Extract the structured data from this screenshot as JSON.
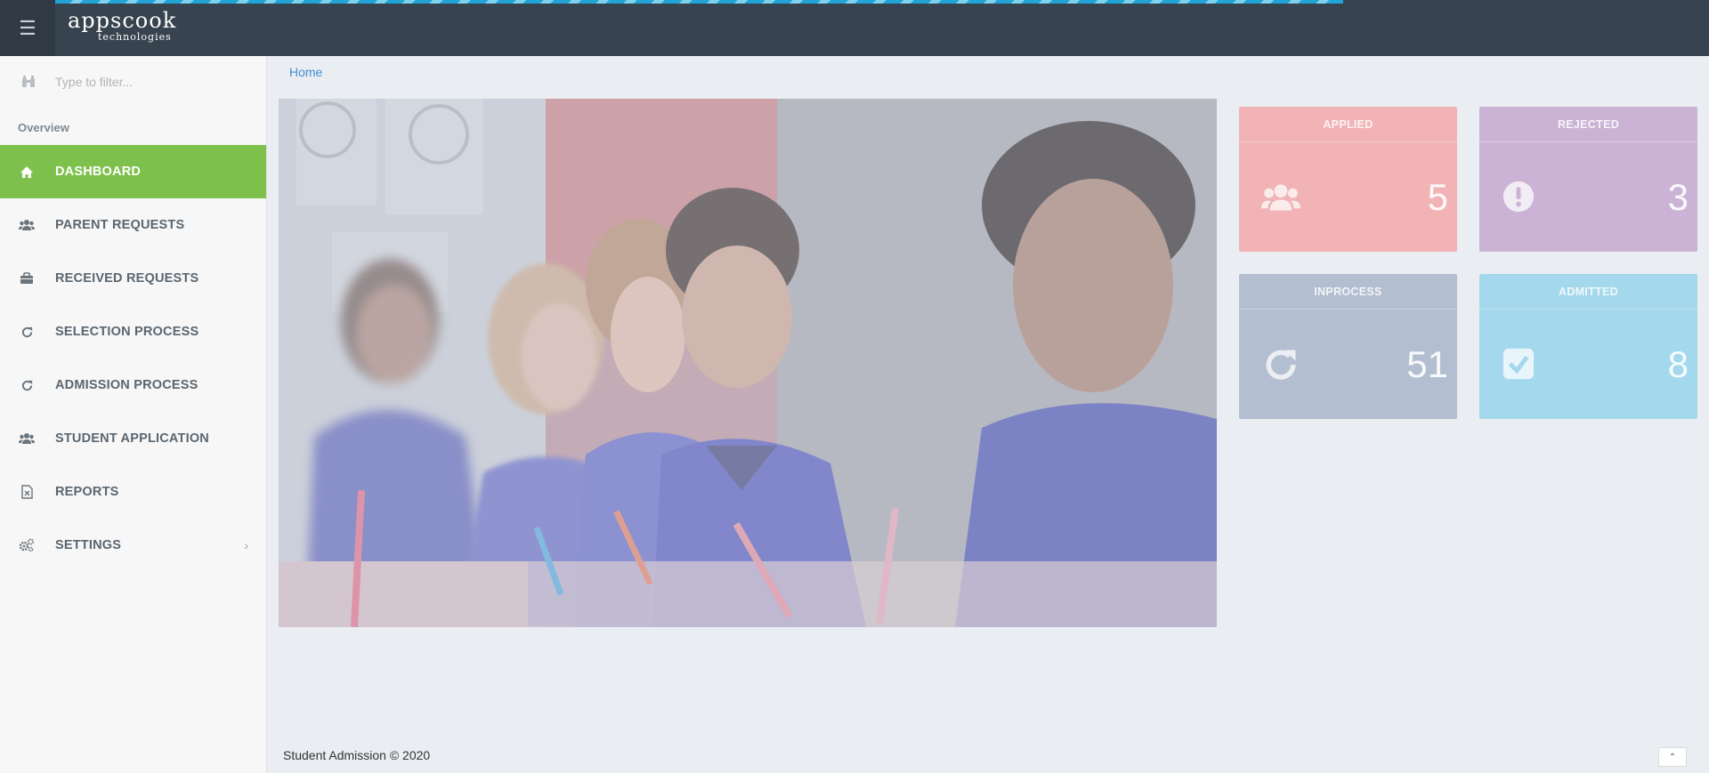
{
  "header": {
    "logo_main": "appscook",
    "logo_sub": "technologies",
    "menu_icon": "hamburger-icon"
  },
  "sidebar": {
    "filter_placeholder": "Type to filter...",
    "filter_icon": "binoculars-icon",
    "section_label": "Overview",
    "items": [
      {
        "label": "DASHBOARD",
        "icon": "home-icon",
        "active": true
      },
      {
        "label": "PARENT REQUESTS",
        "icon": "users-icon"
      },
      {
        "label": "RECEIVED REQUESTS",
        "icon": "briefcase-icon"
      },
      {
        "label": "SELECTION PROCESS",
        "icon": "refresh-icon"
      },
      {
        "label": "ADMISSION PROCESS",
        "icon": "refresh-icon"
      },
      {
        "label": "STUDENT APPLICATION",
        "icon": "users-icon"
      },
      {
        "label": "REPORTS",
        "icon": "excel-file-icon"
      },
      {
        "label": "SETTINGS",
        "icon": "cogs-icon",
        "has_submenu": true
      }
    ]
  },
  "breadcrumb": {
    "home": "Home"
  },
  "stats": [
    {
      "title": "APPLIED",
      "value": "5",
      "icon": "users-icon",
      "color": "#f1b3b5"
    },
    {
      "title": "REJECTED",
      "value": "3",
      "icon": "exclamation-icon",
      "color": "#cbb3d6"
    },
    {
      "title": "INPROCESS",
      "value": "51",
      "icon": "refresh-icon",
      "color": "#b3bed1"
    },
    {
      "title": "ADMITTED",
      "value": "8",
      "icon": "check-square-icon",
      "color": "#a4d8ec"
    }
  ],
  "footer": {
    "text": "Student Admission © 2020",
    "scroll_top_icon": "chevron-up-icon"
  },
  "colors": {
    "topbar": "#37444f",
    "active_nav": "#7dc14c",
    "link": "#3f8fd6"
  }
}
